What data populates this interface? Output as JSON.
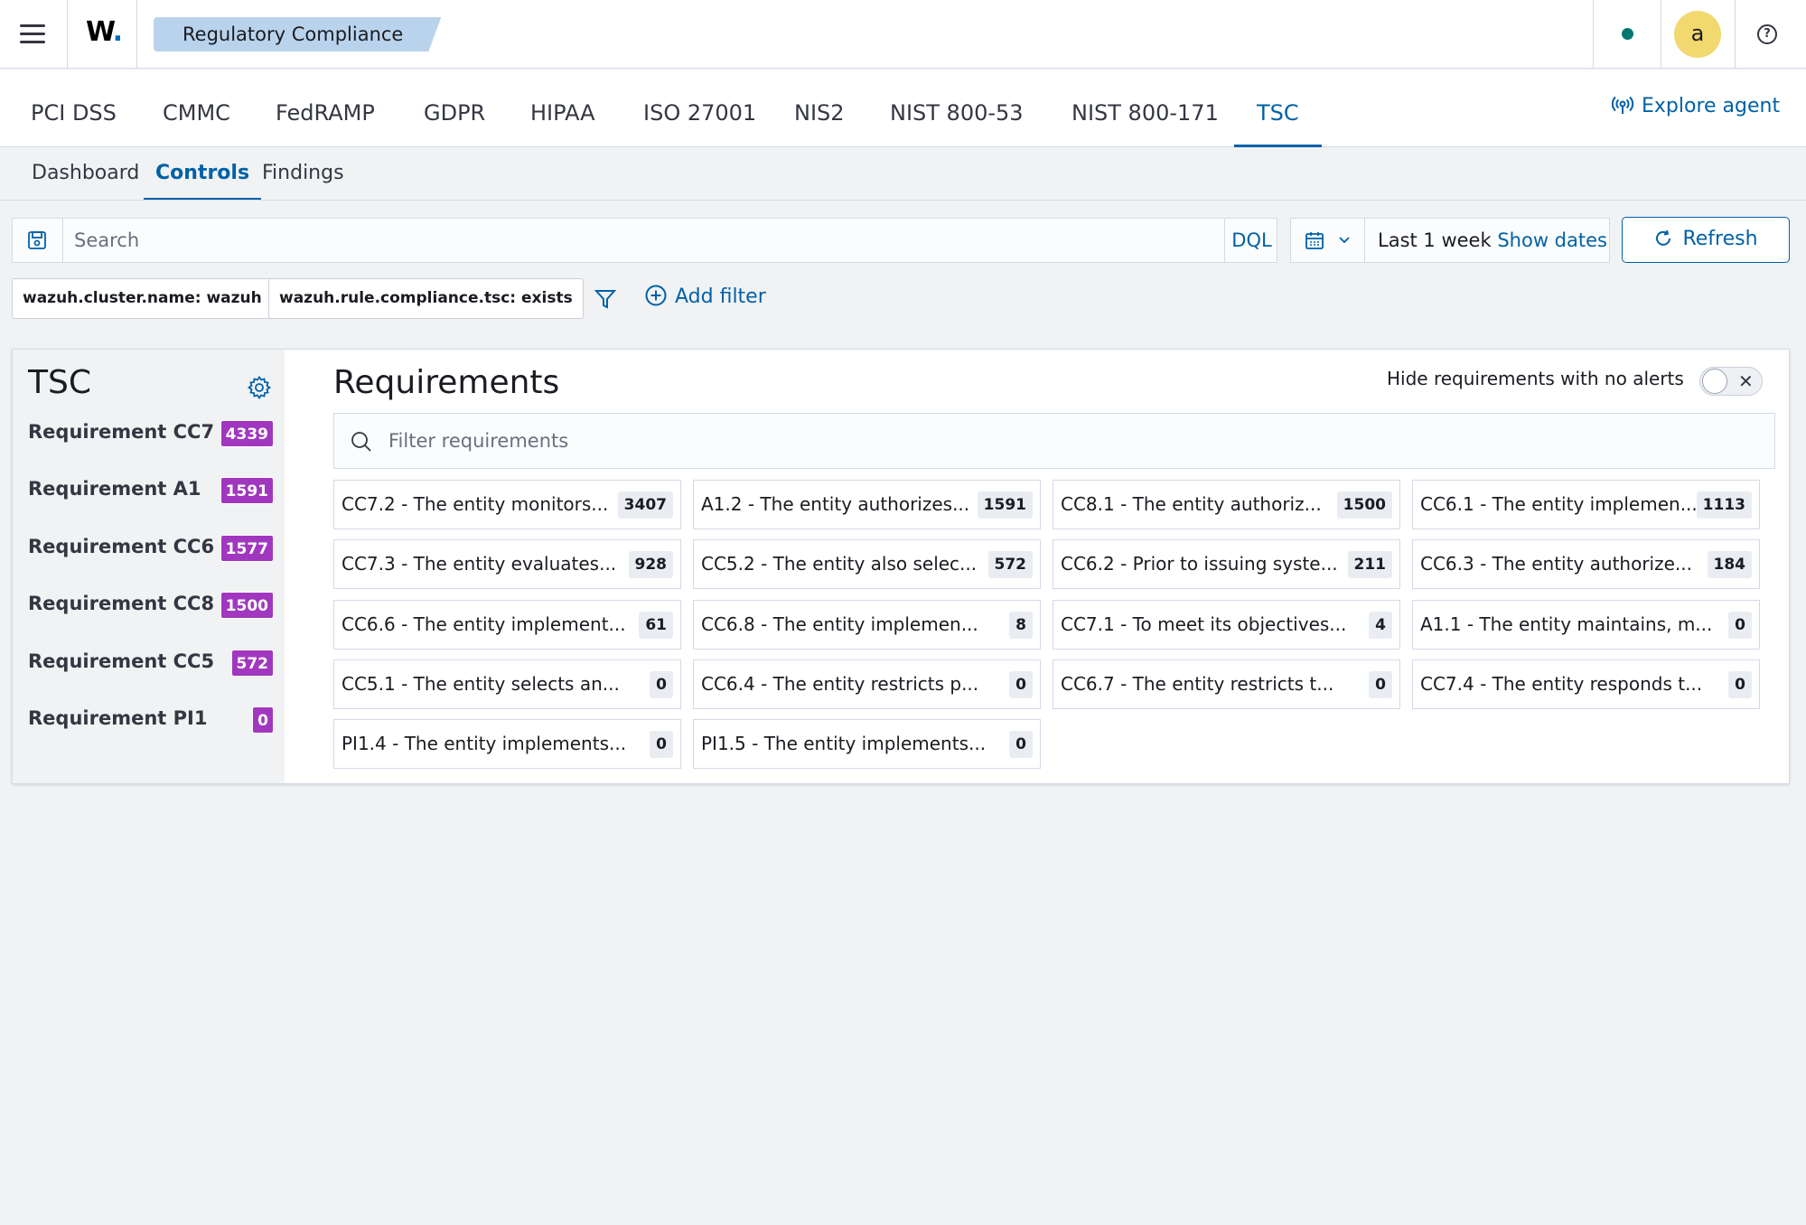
{
  "header": {
    "logo": "W",
    "logo_dot": ".",
    "breadcrumb": "Regulatory Compliance",
    "avatar_initial": "a",
    "help_glyph": "?"
  },
  "compliance_tabs": [
    "PCI DSS",
    "CMMC",
    "FedRAMP",
    "GDPR",
    "HIPAA",
    "ISO 27001",
    "NIS2",
    "NIST 800-53",
    "NIST 800-171",
    "TSC"
  ],
  "active_compliance_tab": "TSC",
  "explore_agent": "Explore agent",
  "sub_tabs": [
    "Dashboard",
    "Controls",
    "Findings"
  ],
  "active_sub_tab": "Controls",
  "search": {
    "placeholder": "Search",
    "dql": "DQL",
    "time_range": "Last 1 week",
    "show_dates": "Show dates",
    "refresh": "Refresh"
  },
  "filters": {
    "pills": [
      "wazuh.cluster.name: wazuh",
      "wazuh.rule.compliance.tsc: exists"
    ],
    "add_filter": "Add filter"
  },
  "sidebar": {
    "title": "TSC",
    "items": [
      {
        "label": "Requirement CC7",
        "count": "4339"
      },
      {
        "label": "Requirement A1",
        "count": "1591"
      },
      {
        "label": "Requirement CC6",
        "count": "1577"
      },
      {
        "label": "Requirement CC8",
        "count": "1500"
      },
      {
        "label": "Requirement CC5",
        "count": "572"
      },
      {
        "label": "Requirement PI1",
        "count": "0"
      }
    ]
  },
  "requirements": {
    "title": "Requirements",
    "hide_label": "Hide requirements with no alerts",
    "toggle_x": "✕",
    "filter_placeholder": "Filter requirements",
    "cards": [
      {
        "text": "CC7.2 - The entity monitors...",
        "count": "3407"
      },
      {
        "text": "A1.2 - The entity authorizes...",
        "count": "1591"
      },
      {
        "text": "CC8.1 - The entity authoriz...",
        "count": "1500"
      },
      {
        "text": "CC6.1 - The entity implemen...",
        "count": "1113"
      },
      {
        "text": "CC7.3 - The entity evaluates...",
        "count": "928"
      },
      {
        "text": "CC5.2 - The entity also selec...",
        "count": "572"
      },
      {
        "text": "CC6.2 - Prior to issuing syste...",
        "count": "211"
      },
      {
        "text": "CC6.3 - The entity authorize...",
        "count": "184"
      },
      {
        "text": "CC6.6 - The entity implement...",
        "count": "61"
      },
      {
        "text": "CC6.8 - The entity implemen...",
        "count": "8"
      },
      {
        "text": "CC7.1 - To meet its objectives...",
        "count": "4"
      },
      {
        "text": "A1.1 - The entity maintains, m...",
        "count": "0"
      },
      {
        "text": "CC5.1 - The entity selects an...",
        "count": "0"
      },
      {
        "text": "CC6.4 - The entity restricts p...",
        "count": "0"
      },
      {
        "text": "CC6.7 - The entity restricts t...",
        "count": "0"
      },
      {
        "text": "CC7.4 - The entity responds t...",
        "count": "0"
      },
      {
        "text": "PI1.4 - The entity implements...",
        "count": "0"
      },
      {
        "text": "PI1.5 - The entity implements...",
        "count": "0"
      }
    ]
  },
  "colors": {
    "accent": "#0061a6",
    "badge_purple": "#a037be",
    "breadcrumb_bg": "#b9d3ec",
    "status_green": "#007871",
    "avatar_bg": "#f1d86f"
  },
  "icons": {
    "menu": "hamburger-menu-icon",
    "status": "status-dot-icon",
    "help": "help-icon",
    "explore": "broadcast-icon",
    "save": "save-query-icon",
    "calendar": "calendar-icon",
    "refresh": "refresh-icon",
    "filter": "funnel-icon",
    "add": "plus-circle-icon",
    "settings": "gear-icon",
    "search": "search-icon"
  }
}
